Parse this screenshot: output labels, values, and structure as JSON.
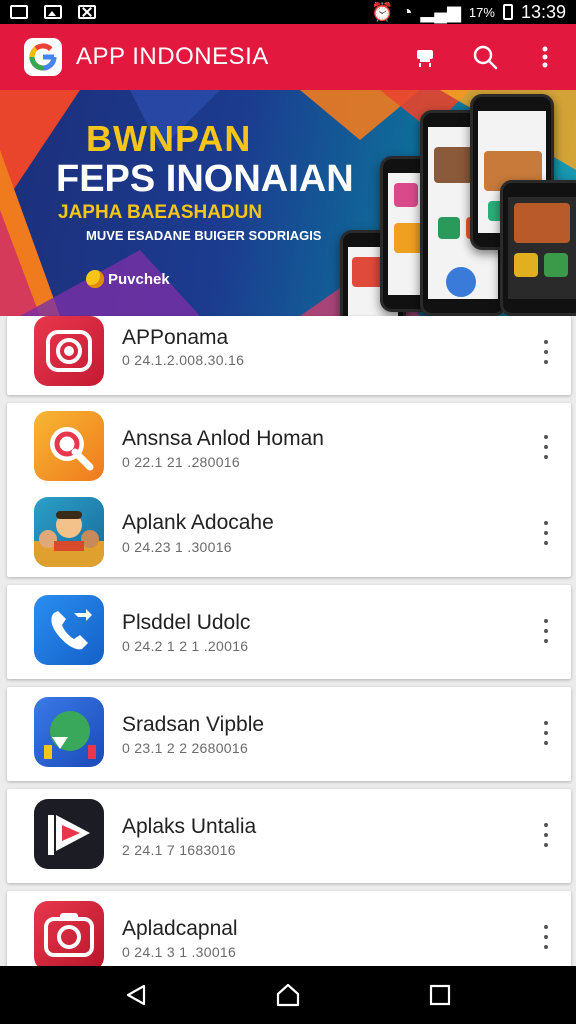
{
  "status_bar": {
    "time": "13:39",
    "signal_text": "17%"
  },
  "app_bar": {
    "title": "APP INDONESIA",
    "logo_letter": "G"
  },
  "banner": {
    "headline": "BWNPAN",
    "title": "FEPS INONAIAN",
    "subtitle": "JAPHA BAEASHADUN",
    "tagline": "MUVE ESADANE BUIGER SODRIAGIS",
    "brand": "Puvchek"
  },
  "apps": [
    {
      "name": "APPonama",
      "meta": "0 24.1.2.008.30.16"
    },
    {
      "name": "Ansnsa Anlod Homan",
      "meta": "0 22.1 21 .280016"
    },
    {
      "name": "Aplank Adocahe",
      "meta": "0 24.23 1 .30016"
    },
    {
      "name": "Plsddel Udolc",
      "meta": "0 24.2 1 2 1 .20016"
    },
    {
      "name": "Sradsan Vipble",
      "meta": "0 23.1 2 2 2680016"
    },
    {
      "name": "Aplaks Untalia",
      "meta": "2 24.1 7 1683016"
    },
    {
      "name": "Apladcapnal",
      "meta": "0 24.1 3 1 .30016"
    }
  ],
  "colors": {
    "app_bar": "#e3183e",
    "banner_yellow": "#f5c518"
  },
  "icons": {
    "logo": "google-g-logo",
    "store": "store-icon",
    "search": "search-icon",
    "menu": "more-vert-icon"
  }
}
